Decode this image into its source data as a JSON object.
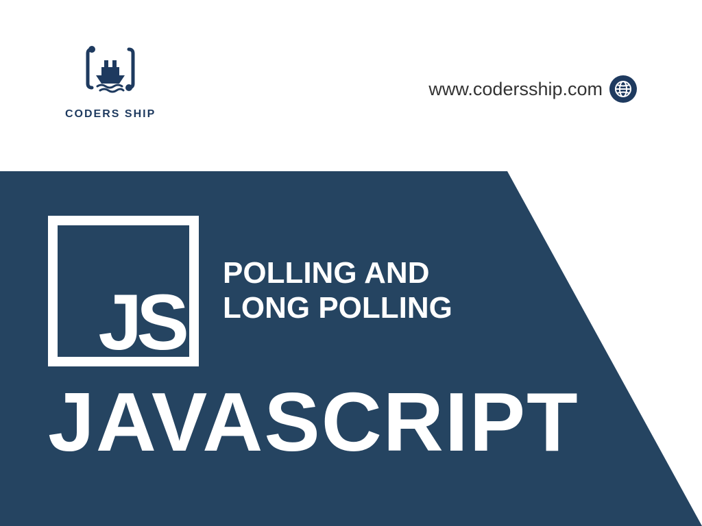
{
  "header": {
    "logo_text": "CODERS SHIP",
    "url": "www.codersship.com"
  },
  "banner": {
    "js_label": "JS",
    "subtitle_line1": "POLLING AND",
    "subtitle_line2": "LONG POLLING",
    "title": "JAVASCRIPT"
  },
  "colors": {
    "primary": "#1e3a5f",
    "banner_bg": "#254461"
  }
}
